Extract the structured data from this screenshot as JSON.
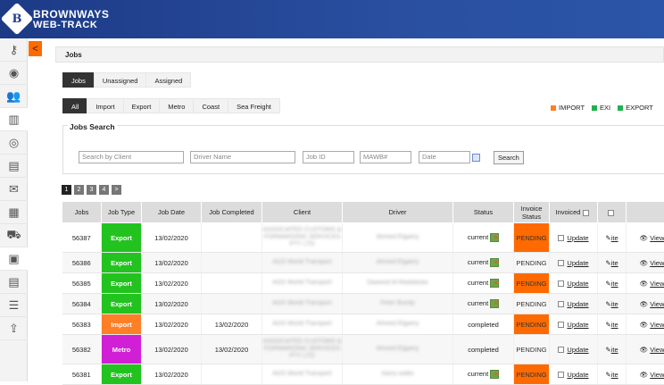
{
  "app": {
    "brand_line1": "BROWNWAYS",
    "brand_line2": "WEB-TRACK",
    "logo_letter": "B"
  },
  "sidebar": {
    "collapse_label": "<",
    "items": [
      "key-icon",
      "user-circle-icon",
      "users-icon",
      "warehouse-icon",
      "globe-icon",
      "document-icon",
      "mail-icon",
      "receipt-icon",
      "truck-icon",
      "clipboard-icon",
      "checklist-icon",
      "list-icon",
      "upload-icon"
    ]
  },
  "panel": {
    "title": "Jobs"
  },
  "tabs": [
    {
      "label": "Jobs",
      "active": true
    },
    {
      "label": "Unassigned"
    },
    {
      "label": "Assigned"
    }
  ],
  "type_tabs": [
    {
      "label": "All",
      "active": true
    },
    {
      "label": "Import"
    },
    {
      "label": "Export"
    },
    {
      "label": "Metro"
    },
    {
      "label": "Coast"
    },
    {
      "label": "Sea Freight"
    }
  ],
  "legend": [
    {
      "label": "IMPORT",
      "color": "#ff7f27"
    },
    {
      "label": "EXI",
      "color": "#22b14c"
    },
    {
      "label": "EXPORT",
      "color": "#22b14c"
    }
  ],
  "search": {
    "title": "Jobs Search",
    "client_placeholder": "Search by Client",
    "driver_placeholder": "Driver Name",
    "jobid_placeholder": "Job ID",
    "mawb_placeholder": "MAWB#",
    "date_placeholder": "Date",
    "button": "Search"
  },
  "pager": [
    "1",
    "2",
    "3",
    "4",
    ">"
  ],
  "columns": [
    "Jobs",
    "Job Type",
    "Job Date",
    "Job Completed",
    "Client",
    "Driver",
    "Status",
    "Invoice Status",
    "Invoiced",
    "",
    ""
  ],
  "colors": {
    "Export": "#22c31f",
    "Import": "#ff7f27",
    "Metro": "#d11fd6",
    "invoice": "#ff6a00"
  },
  "rows": [
    {
      "job": "56387",
      "type": "Export",
      "date": "13/02/2020",
      "completed": "",
      "client": "ASSOCIATED CUSTOMS & FORWARDING SERVICES PTY LTD",
      "driver": "Ahmed Elgaery",
      "status": "current",
      "invoice": "PENDING",
      "update": "Update",
      "view": "View"
    },
    {
      "job": "56386",
      "type": "Export",
      "date": "13/02/2020",
      "completed": "",
      "client": "AGS World Transport",
      "driver": "Ahmed Elgaery",
      "status": "current",
      "invoice": "PENDING",
      "update": "Update",
      "view": "View"
    },
    {
      "job": "56385",
      "type": "Export",
      "date": "13/02/2020",
      "completed": "",
      "client": "AGS World Transport",
      "driver": "Dawood Al-Maddaraw",
      "status": "current",
      "invoice": "PENDING",
      "update": "Update",
      "view": "View"
    },
    {
      "job": "56384",
      "type": "Export",
      "date": "13/02/2020",
      "completed": "",
      "client": "AGS World Transport",
      "driver": "Peter Bundy",
      "status": "current",
      "invoice": "PENDING",
      "update": "Update",
      "view": "View"
    },
    {
      "job": "56383",
      "type": "Import",
      "date": "13/02/2020",
      "completed": "13/02/2020",
      "client": "AGS World Transport",
      "driver": "Ahmed Elgaery",
      "status": "completed",
      "invoice": "PENDING",
      "update": "Update",
      "view": "View"
    },
    {
      "job": "56382",
      "type": "Metro",
      "date": "13/02/2020",
      "completed": "13/02/2020",
      "client": "ASSOCIATED CUSTOMS & FORWARDING SERVICES PTY LTD",
      "driver": "Ahmed Elgaery",
      "status": "completed",
      "invoice": "PENDING",
      "update": "Update",
      "view": "View"
    },
    {
      "job": "56381",
      "type": "Export",
      "date": "13/02/2020",
      "completed": "",
      "client": "AGS World Transport",
      "driver": "Garry wallis",
      "status": "current",
      "invoice": "PENDING",
      "update": "Update",
      "view": "View"
    }
  ],
  "site_link": "ite"
}
